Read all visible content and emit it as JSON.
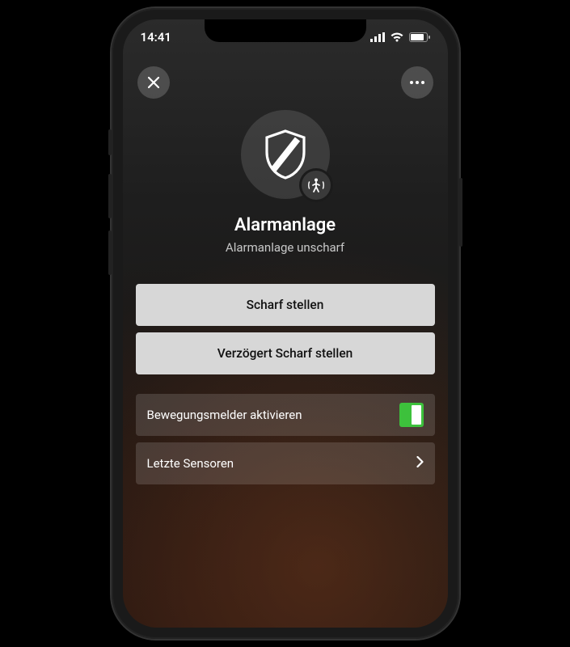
{
  "status": {
    "time": "14:41"
  },
  "hero": {
    "title": "Alarmanlage",
    "subtitle": "Alarmanlage unscharf"
  },
  "actions": {
    "arm": "Scharf stellen",
    "arm_delayed": "Verzögert Scharf stellen"
  },
  "options": {
    "motion_label": "Bewegungsmelder aktivieren",
    "motion_on": true,
    "last_sensors_label": "Letzte Sensoren"
  },
  "colors": {
    "toggle_on": "#3dc13c"
  }
}
